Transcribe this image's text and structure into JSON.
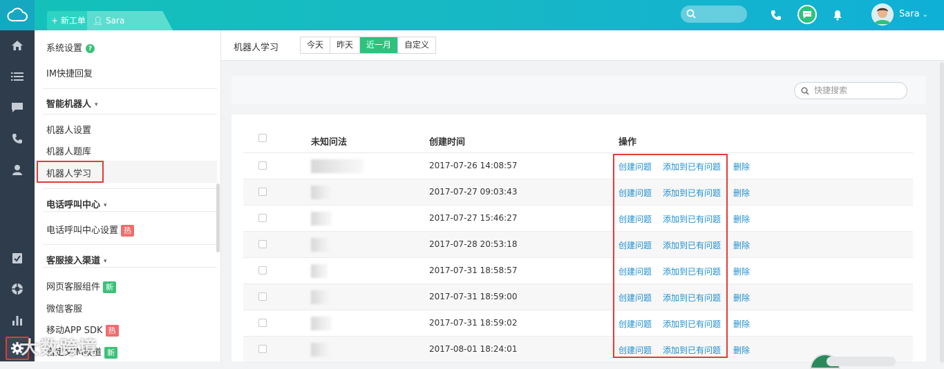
{
  "topbar": {
    "new_ticket": "+ 新工单",
    "user_tab": "Sara",
    "user_name": "Sara"
  },
  "sidebar": {
    "system_settings": "系统设置",
    "im_quick_reply": "IM快捷回复",
    "group_robot": "智能机器人",
    "robot_settings": "机器人设置",
    "robot_library": "机器人题库",
    "robot_learning": "机器人学习",
    "group_call_center": "电话呼叫中心",
    "call_center_settings": "电话呼叫中心设置",
    "hot_badge": "热",
    "group_channels": "客服接入渠道",
    "web_widget": "网页客服组件",
    "new_badge": "新",
    "wechat": "微信客服",
    "mobile_sdk": "移动APP SDK",
    "custom_im": "自定义IM渠道",
    "watermark": "大数跨境"
  },
  "main": {
    "title": "机器人学习",
    "filters": [
      "今天",
      "昨天",
      "近一月",
      "自定义"
    ],
    "active_filter": "近一月",
    "search_placeholder": "快捷搜索",
    "columns": {
      "unknown_question": "未知问法",
      "created_time": "创建时间",
      "actions": "操作"
    },
    "actions": {
      "create": "创建问题",
      "add_existing": "添加到已有问题",
      "delete": "删除"
    },
    "rows": [
      {
        "time": "2017-07-26 14:08:57"
      },
      {
        "time": "2017-07-27 09:03:43"
      },
      {
        "time": "2017-07-27 15:46:27"
      },
      {
        "time": "2017-07-28 20:53:18"
      },
      {
        "time": "2017-07-31 18:58:57"
      },
      {
        "time": "2017-07-31 18:59:00"
      },
      {
        "time": "2017-07-31 18:59:02"
      },
      {
        "time": "2017-08-01 18:24:01"
      }
    ]
  },
  "colors": {
    "accent": "#2ec27e",
    "link": "#1f8fd0",
    "topbar": "#13c2b8",
    "nav": "#2f3c4c",
    "highlight": "#e53935"
  }
}
